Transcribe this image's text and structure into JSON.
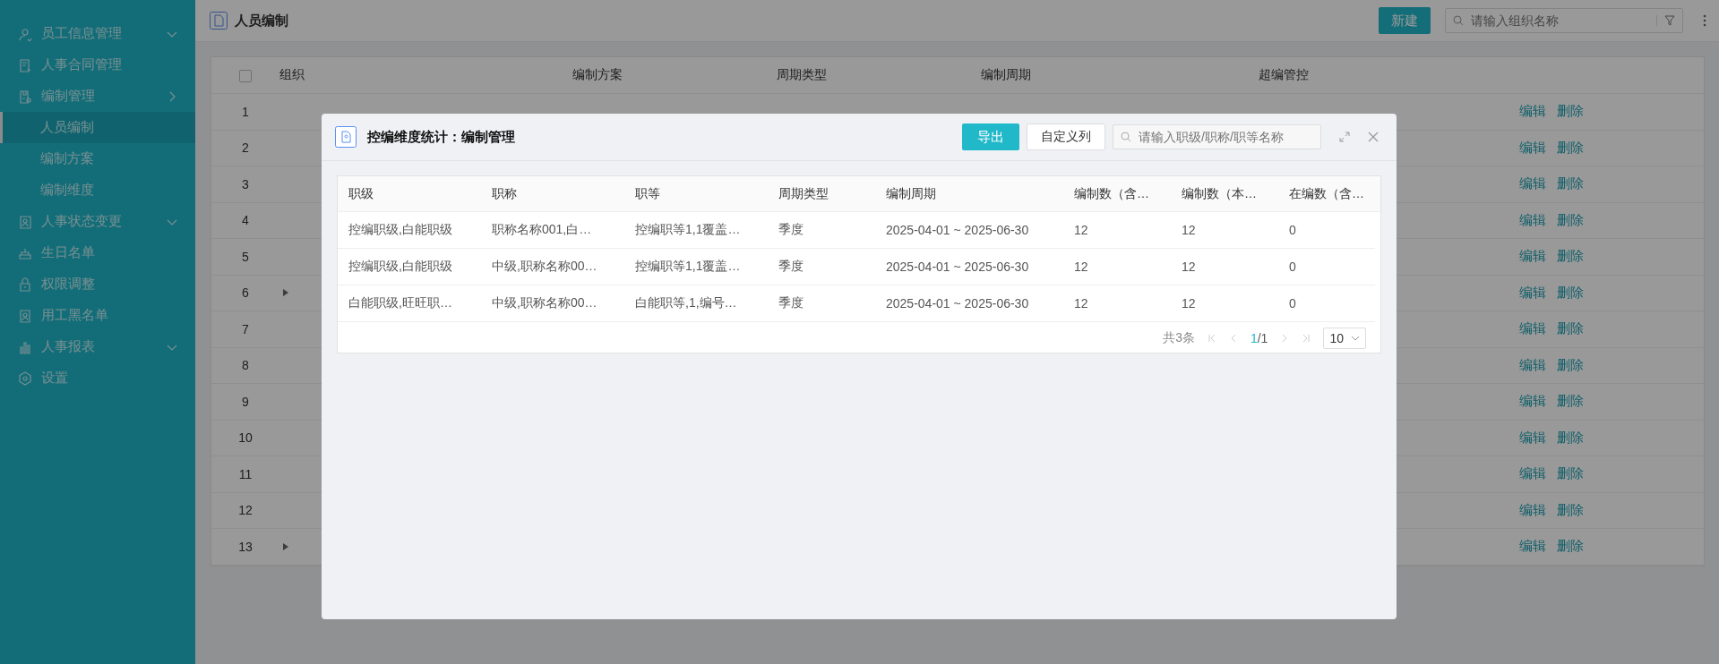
{
  "sidebar": {
    "items": [
      {
        "label": "员工信息管理",
        "has_submenu": true,
        "open": false,
        "selected": false
      },
      {
        "label": "人事合同管理",
        "selected": false
      },
      {
        "label": "编制管理",
        "has_submenu": true,
        "open": true,
        "selected": false,
        "children": [
          {
            "label": "人员编制",
            "selected": true
          },
          {
            "label": "编制方案",
            "selected": false
          },
          {
            "label": "编制维度",
            "selected": false
          }
        ]
      },
      {
        "label": "人事状态变更",
        "has_submenu": true,
        "open": false,
        "selected": false
      },
      {
        "label": "生日名单",
        "selected": false
      },
      {
        "label": "权限调整",
        "selected": false
      },
      {
        "label": "用工黑名单",
        "selected": false
      },
      {
        "label": "人事报表",
        "has_submenu": true,
        "open": false,
        "selected": false
      },
      {
        "label": "设置",
        "selected": false
      }
    ]
  },
  "header": {
    "title": "人员编制",
    "new_button": "新建",
    "search": {
      "placeholder": "请输入组织名称"
    }
  },
  "table": {
    "select_all": {
      "checked": false
    },
    "columns": [
      "组织",
      "编制方案",
      "周期类型",
      "编制周期",
      "超编管控"
    ],
    "rows": [
      {
        "index": "1",
        "expandable": false,
        "actions": [
          "编辑",
          "删除"
        ]
      },
      {
        "index": "2",
        "expandable": false,
        "actions": [
          "编辑",
          "删除"
        ]
      },
      {
        "index": "3",
        "expandable": false,
        "actions": [
          "编辑",
          "删除"
        ]
      },
      {
        "index": "4",
        "expandable": false,
        "actions": [
          "编辑",
          "删除"
        ]
      },
      {
        "index": "5",
        "expandable": false,
        "actions": [
          "编辑",
          "删除"
        ]
      },
      {
        "index": "6",
        "expandable": true,
        "actions": [
          "编辑",
          "删除"
        ]
      },
      {
        "index": "7",
        "expandable": false,
        "actions": [
          "编辑",
          "删除"
        ]
      },
      {
        "index": "8",
        "expandable": false,
        "actions": [
          "编辑",
          "删除"
        ]
      },
      {
        "index": "9",
        "expandable": false,
        "actions": [
          "编辑",
          "删除"
        ]
      },
      {
        "index": "10",
        "expandable": false,
        "actions": [
          "编辑",
          "删除"
        ]
      },
      {
        "index": "11",
        "expandable": false,
        "actions": [
          "编辑",
          "删除"
        ]
      },
      {
        "index": "12",
        "expandable": false,
        "actions": [
          "编辑",
          "删除"
        ]
      },
      {
        "index": "13",
        "expandable": true,
        "actions": [
          "编辑",
          "删除"
        ]
      }
    ]
  },
  "dialog": {
    "title": "控编维度统计：编制管理",
    "export_button": "导出",
    "columns_button": "自定义列",
    "search": {
      "placeholder": "请输入职级/职称/职等名称"
    },
    "table": {
      "columns": [
        "职级",
        "职称",
        "职等",
        "周期类型",
        "编制周期",
        "编制数（含…",
        "编制数（本…",
        "在编数（含…"
      ],
      "rows": [
        [
          "控编职级,白能职级",
          "职称名称001,白…",
          "控编职等1,1覆盖…",
          "季度",
          "2025-04-01 ~ 2025-06-30",
          "12",
          "12",
          "0"
        ],
        [
          "控编职级,白能职级",
          "中级,职称名称00…",
          "控编职等1,1覆盖…",
          "季度",
          "2025-04-01 ~ 2025-06-30",
          "12",
          "12",
          "0"
        ],
        [
          "白能职级,旺旺职…",
          "中级,职称名称00…",
          "白能职等,1,编号…",
          "季度",
          "2025-04-01 ~ 2025-06-30",
          "12",
          "12",
          "0"
        ]
      ]
    },
    "pagination": {
      "total": "共3条",
      "current": "1",
      "pages": "/1",
      "page_size": "10",
      "first_disabled": true,
      "prev_disabled": true,
      "next_disabled": true,
      "last_disabled": true
    }
  }
}
